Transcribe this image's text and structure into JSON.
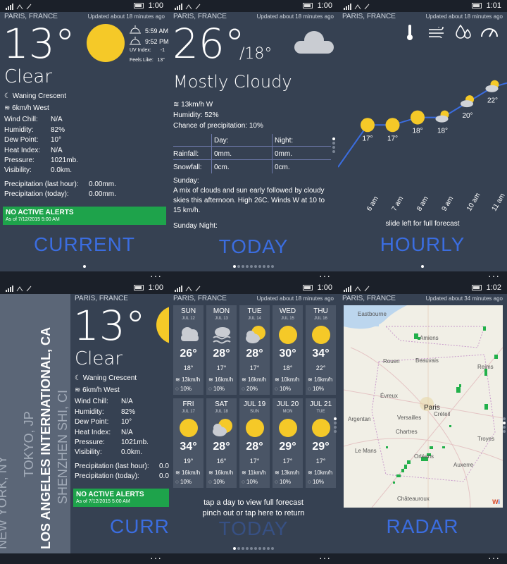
{
  "common": {
    "time": "1:00",
    "time2": "1:02",
    "time3": "1:01",
    "location": "PARIS, FRANCE",
    "updated": "Updated about 18 minutes ago",
    "updated_radar": "Updated about 34 minutes ago"
  },
  "current": {
    "temp": "13°",
    "condition": "Clear",
    "sunrise": "5:59 AM",
    "sunset": "9:52 PM",
    "uv_label": "UV Index:",
    "uv_value": "-1",
    "feels_label": "Feels Like:",
    "feels_value": "13°",
    "moon": "Waning Crescent",
    "wind": "6km/h West",
    "rows": [
      {
        "k": "Wind Chill:",
        "v": "N/A"
      },
      {
        "k": "Humidity:",
        "v": "82%"
      },
      {
        "k": "Dew Point:",
        "v": "10°"
      },
      {
        "k": "Heat Index:",
        "v": "N/A"
      },
      {
        "k": "Pressure:",
        "v": "1021mb."
      },
      {
        "k": "Visibility:",
        "v": "0.0km."
      }
    ],
    "precip_last_label": "Precipitation (last hour):",
    "precip_last_value": "0.00mm.",
    "precip_today_label": "Precipitation (today):",
    "precip_today_value": "0.00mm.",
    "alert_title": "NO ACTIVE ALERTS",
    "alert_sub": "As of 7/12/2015 5:00 AM",
    "page_title": "CURRENT",
    "page_title_cut": "CURRE",
    "precip_last_cut": "0.0",
    "precip_today_cut": "0.0"
  },
  "today": {
    "temp": "26°",
    "low": "/18°",
    "condition": "Mostly Cloudy",
    "wind": "13km/h W",
    "humidity": "Humidity: 52%",
    "chance": "Chance of precipitation: 10%",
    "col_day": "Day:",
    "col_night": "Night:",
    "rain_label": "Rainfall:",
    "rain_day": "0mm.",
    "rain_night": "0mm.",
    "snow_label": "Snowfall:",
    "snow_day": "0cm.",
    "snow_night": "0cm.",
    "sunday_label": "Sunday:",
    "sunday_text": "A mix of clouds and sun early followed by cloudy skies this afternoon. High 26C. Winds W at 10 to 15 km/h.",
    "sunday_night_label": "Sunday Night:",
    "page_title": "TODAY"
  },
  "hourly": {
    "hint": "slide left for full forecast",
    "page_title": "HOURLY",
    "points": [
      {
        "time": "6 am",
        "temp": "17°",
        "icon": "sun"
      },
      {
        "time": "7 am",
        "temp": "17°",
        "icon": "sun"
      },
      {
        "time": "8 am",
        "temp": "18°",
        "icon": "sun"
      },
      {
        "time": "9 am",
        "temp": "18°",
        "icon": "partly-cloudy"
      },
      {
        "time": "10 am",
        "temp": "20°",
        "icon": "partly-cloudy"
      },
      {
        "time": "11 am",
        "temp": "22°",
        "icon": "partly-cloudy"
      }
    ]
  },
  "locations": [
    "NEW YORK, NY",
    "TOKYO, JP",
    "LOS ANGELES INTERNATIONAL, CA",
    "SHENZHEN SHI, CI"
  ],
  "forecast": {
    "hint1": "tap a day to view full forecast",
    "hint2": "pinch out or tap here to return",
    "days": [
      {
        "name": "SUN",
        "date": "JUL 12",
        "hi": "26°",
        "lo": "18°",
        "wind": "13km/h",
        "pop": "10%",
        "icon": "cloudy"
      },
      {
        "name": "MON",
        "date": "JUL 13",
        "hi": "28°",
        "lo": "17°",
        "wind": "16km/h",
        "pop": "10%",
        "icon": "fog"
      },
      {
        "name": "TUE",
        "date": "JUL 14",
        "hi": "28°",
        "lo": "17°",
        "wind": "16km/h",
        "pop": "20%",
        "icon": "partly-cloudy"
      },
      {
        "name": "WED",
        "date": "JUL 15",
        "hi": "30°",
        "lo": "18°",
        "wind": "10km/h",
        "pop": "10%",
        "icon": "sun"
      },
      {
        "name": "THU",
        "date": "JUL 16",
        "hi": "34°",
        "lo": "22°",
        "wind": "16km/h",
        "pop": "10%",
        "icon": "sun"
      },
      {
        "name": "FRI",
        "date": "JUL 17",
        "hi": "34°",
        "lo": "19°",
        "wind": "16km/h",
        "pop": "10%",
        "icon": "sun"
      },
      {
        "name": "SAT",
        "date": "JUL 18",
        "hi": "28°",
        "lo": "16°",
        "wind": "16km/h",
        "pop": "10%",
        "icon": "partly-cloudy"
      },
      {
        "name": "JUL 19",
        "date": "SUN",
        "hi": "28°",
        "lo": "17°",
        "wind": "11km/h",
        "pop": "10%",
        "icon": "sun"
      },
      {
        "name": "JUL 20",
        "date": "MON",
        "hi": "29°",
        "lo": "17°",
        "wind": "13km/h",
        "pop": "10%",
        "icon": "sun"
      },
      {
        "name": "JUL 21",
        "date": "TUE",
        "hi": "29°",
        "lo": "17°",
        "wind": "10km/h",
        "pop": "10%",
        "icon": "sun"
      }
    ]
  },
  "radar": {
    "page_title": "RADAR",
    "labels": [
      "Eastbourne",
      "Amiens",
      "Rouen",
      "Beauvais",
      "Reims",
      "Évreux",
      "Paris",
      "Versailles",
      "Créteil",
      "Argentan",
      "Chartres",
      "Troyes",
      "Le Mans",
      "Orléans",
      "Auxerre",
      "Châteauroux"
    ]
  }
}
